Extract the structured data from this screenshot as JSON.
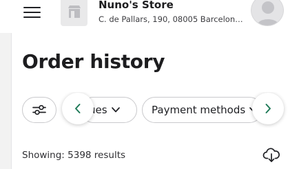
{
  "header": {
    "menu_icon": "hamburger-menu-icon",
    "store_thumbnail_icon": "store-icon",
    "store_name": "Nuno's Store",
    "store_address": "C. de Pallars, 190, 08005 Barcelona,...",
    "avatar_icon": "user-avatar-icon"
  },
  "page": {
    "title": "Order history"
  },
  "filters": {
    "settings_icon": "sliders-icon",
    "chips": [
      {
        "label": "ues"
      },
      {
        "label": "Payment methods"
      }
    ],
    "prev_icon": "chevron-left-icon",
    "next_icon": "chevron-right-icon"
  },
  "results": {
    "text": "Showing: 5398 results",
    "download_icon": "cloud-download-icon"
  },
  "colors": {
    "accent": "#1f7a58",
    "text": "#202125",
    "background": "#f2f2f2"
  }
}
